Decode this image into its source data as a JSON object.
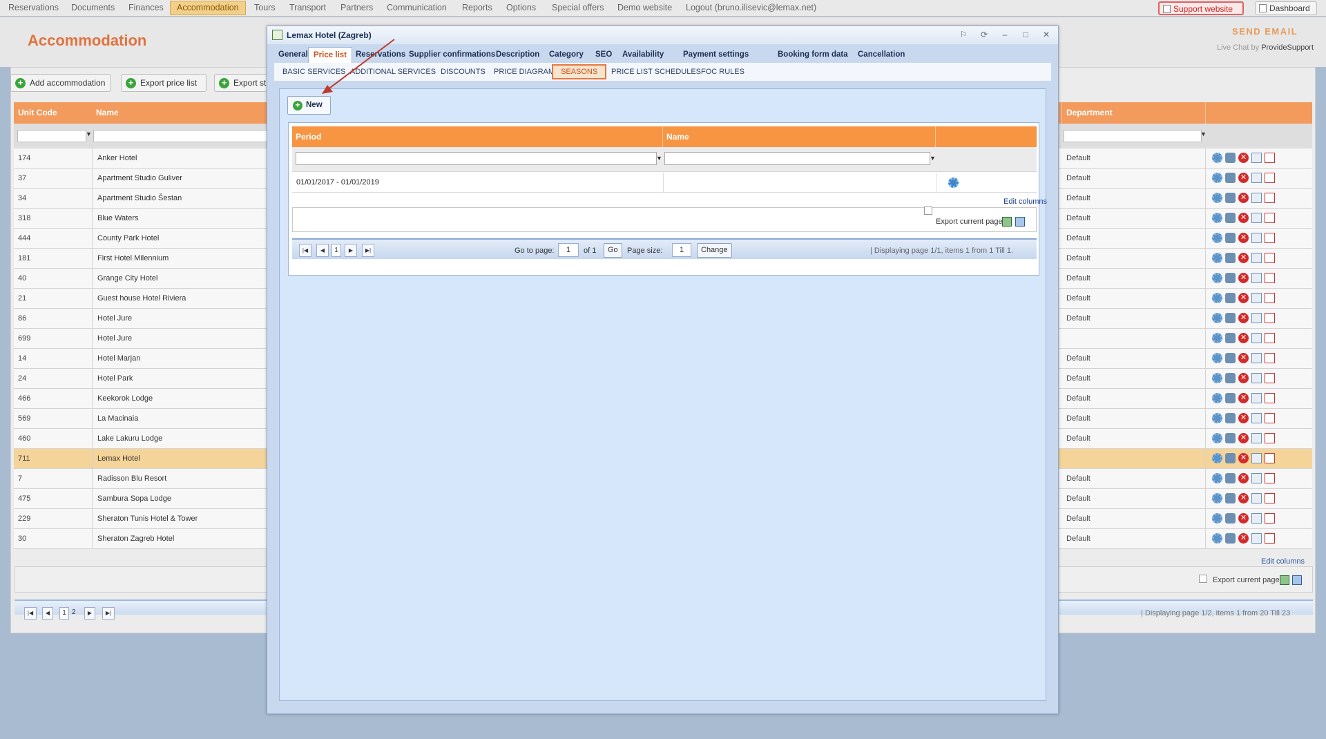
{
  "topnav": {
    "items": [
      "Reservations",
      "Documents",
      "Finances",
      "Accommodation",
      "Tours",
      "Transport",
      "Partners",
      "Communication",
      "Reports",
      "Options",
      "Special offers",
      "Demo website",
      "Logout (bruno.ilisevic@lemax.net)"
    ],
    "active": "Accommodation",
    "support_label": "Support website",
    "dashboard_label": "Dashboard"
  },
  "header": {
    "page_title": "Accommodation",
    "send_email": "SEND EMAIL",
    "live_chat_prefix": "Live Chat by ",
    "live_chat_brand": "ProvideSupport"
  },
  "toolbar": {
    "add_accommodation": "Add accommodation",
    "export_price_list": "Export price list",
    "export_st": "Export st"
  },
  "bg_table": {
    "columns": [
      "Unit Code",
      "Name",
      "Department"
    ],
    "rows": [
      {
        "code": "174",
        "name": "Anker Hotel",
        "dept": "Default"
      },
      {
        "code": "37",
        "name": "Apartment Studio Guliver",
        "dept": "Default"
      },
      {
        "code": "34",
        "name": "Apartment Studio Šestan",
        "dept": "Default"
      },
      {
        "code": "318",
        "name": "Blue Waters",
        "dept": "Default"
      },
      {
        "code": "444",
        "name": "County Park Hotel",
        "dept": "Default"
      },
      {
        "code": "181",
        "name": "First Hotel Milennium",
        "dept": "Default"
      },
      {
        "code": "40",
        "name": "Grange City Hotel",
        "dept": "Default"
      },
      {
        "code": "21",
        "name": "Guest house Hotel Riviera",
        "dept": "Default"
      },
      {
        "code": "86",
        "name": "Hotel Jure",
        "dept": "Default"
      },
      {
        "code": "699",
        "name": "Hotel Jure",
        "dept": ""
      },
      {
        "code": "14",
        "name": "Hotel Marjan",
        "dept": "Default"
      },
      {
        "code": "24",
        "name": "Hotel Park",
        "dept": "Default"
      },
      {
        "code": "466",
        "name": "Keekorok Lodge",
        "dept": "Default"
      },
      {
        "code": "569",
        "name": "La Macinaia",
        "dept": "Default"
      },
      {
        "code": "460",
        "name": "Lake Lakuru Lodge",
        "dept": "Default"
      },
      {
        "code": "711",
        "name": "Lemax Hotel",
        "dept": "",
        "selected": true
      },
      {
        "code": "7",
        "name": "Radisson Blu Resort",
        "dept": "Default"
      },
      {
        "code": "475",
        "name": "Sambura Sopa Lodge",
        "dept": "Default"
      },
      {
        "code": "229",
        "name": "Sheraton Tunis Hotel & Tower",
        "dept": "Default"
      },
      {
        "code": "30",
        "name": "Sheraton Zagreb Hotel",
        "dept": "Default"
      }
    ],
    "edit_columns": "Edit columns",
    "export_current_page": "Export current page",
    "pager_pages": [
      "1",
      "2"
    ],
    "pager_info": "| Displaying page  1/2,  items  1  from  20  Till  23"
  },
  "modal": {
    "title": "Lemax Hotel (Zagreb)",
    "tabs": [
      "General",
      "Price list",
      "Reservations",
      "Supplier confirmations",
      "Description",
      "Category",
      "SEO",
      "Availability",
      "Payment settings",
      "Booking form data",
      "Cancellation"
    ],
    "active_tab": "Price list",
    "subtabs": [
      "BASIC SERVICES",
      "ADDITIONAL SERVICES",
      "DISCOUNTS",
      "PRICE DIAGRAM",
      "SEASONS",
      "PRICE LIST SCHEDULES",
      "FOC RULES"
    ],
    "active_subtab": "SEASONS",
    "new_button": "New",
    "grid": {
      "columns": [
        "Period",
        "Name"
      ],
      "rows": [
        {
          "period": "01/01/2017 - 01/01/2019",
          "name": ""
        }
      ],
      "edit_columns": "Edit columns",
      "export_current_page": "Export current page"
    },
    "pager": {
      "current_page": "1",
      "go_to_page_label": "Go to page:",
      "go_to_page_value": "1",
      "of_label": "of 1",
      "go_button": "Go",
      "page_size_label": "Page size:",
      "page_size_value": "1",
      "change_button": "Change",
      "info": "| Displaying page  1/1,  items  1  from  1  Till  1."
    }
  },
  "colors": {
    "accent_orange": "#f79543",
    "title_orange": "#e0733f",
    "selected_row": "#f5d49a",
    "modal_body": "#d6e6fb",
    "annotation_arrow": "#c0392b"
  }
}
